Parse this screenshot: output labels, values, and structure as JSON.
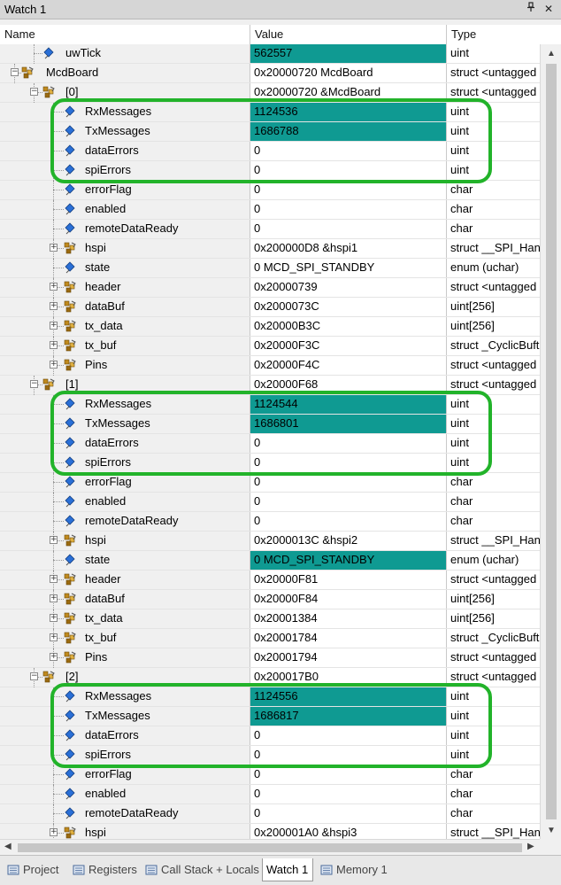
{
  "window": {
    "title": "Watch 1",
    "pin_glyph": "📌",
    "close_glyph": "✕"
  },
  "columns": {
    "name": "Name",
    "value": "Value",
    "type": "Type"
  },
  "rows": [
    {
      "name": "uwTick",
      "value": "562557",
      "type": "uint",
      "depth": 1,
      "expander": "none",
      "icon": "variable-icon",
      "highlight": true
    },
    {
      "name": "McdBoard",
      "value": "0x20000720 McdBoard",
      "type": "struct <untagged",
      "depth": 0,
      "expander": "minus",
      "icon": "struct-icon",
      "highlight": false
    },
    {
      "name": "[0]",
      "value": "0x20000720 &McdBoard",
      "type": "struct <untagged",
      "depth": 1,
      "expander": "minus",
      "icon": "struct-icon",
      "highlight": false
    },
    {
      "name": "RxMessages",
      "value": "1124536",
      "type": "uint",
      "depth": 2,
      "expander": "none",
      "icon": "variable-icon",
      "highlight": true
    },
    {
      "name": "TxMessages",
      "value": "1686788",
      "type": "uint",
      "depth": 2,
      "expander": "none",
      "icon": "variable-icon",
      "highlight": true
    },
    {
      "name": "dataErrors",
      "value": "0",
      "type": "uint",
      "depth": 2,
      "expander": "none",
      "icon": "variable-icon",
      "highlight": false
    },
    {
      "name": "spiErrors",
      "value": "0",
      "type": "uint",
      "depth": 2,
      "expander": "none",
      "icon": "variable-icon",
      "highlight": false
    },
    {
      "name": "errorFlag",
      "value": "0",
      "type": "char",
      "depth": 2,
      "expander": "none",
      "icon": "variable-icon",
      "highlight": false
    },
    {
      "name": "enabled",
      "value": "0",
      "type": "char",
      "depth": 2,
      "expander": "none",
      "icon": "variable-icon",
      "highlight": false
    },
    {
      "name": "remoteDataReady",
      "value": "0",
      "type": "char",
      "depth": 2,
      "expander": "none",
      "icon": "variable-icon",
      "highlight": false
    },
    {
      "name": "hspi",
      "value": "0x200000D8 &hspi1",
      "type": "struct __SPI_Hanc",
      "depth": 2,
      "expander": "plus",
      "icon": "struct-icon",
      "highlight": false
    },
    {
      "name": "state",
      "value": "0 MCD_SPI_STANDBY",
      "type": "enum (uchar)",
      "depth": 2,
      "expander": "none",
      "icon": "variable-icon",
      "highlight": false
    },
    {
      "name": "header",
      "value": "0x20000739",
      "type": "struct <untagged",
      "depth": 2,
      "expander": "plus",
      "icon": "struct-icon",
      "highlight": false
    },
    {
      "name": "dataBuf",
      "value": "0x2000073C",
      "type": "uint[256]",
      "depth": 2,
      "expander": "plus",
      "icon": "struct-icon",
      "highlight": false
    },
    {
      "name": "tx_data",
      "value": "0x20000B3C",
      "type": "uint[256]",
      "depth": 2,
      "expander": "plus",
      "icon": "struct-icon",
      "highlight": false
    },
    {
      "name": "tx_buf",
      "value": "0x20000F3C",
      "type": "struct _CyclicBuft",
      "depth": 2,
      "expander": "plus",
      "icon": "struct-icon",
      "highlight": false
    },
    {
      "name": "Pins",
      "value": "0x20000F4C",
      "type": "struct <untagged",
      "depth": 2,
      "expander": "plus",
      "icon": "struct-icon",
      "highlight": false
    },
    {
      "name": "[1]",
      "value": "0x20000F68",
      "type": "struct <untagged",
      "depth": 1,
      "expander": "minus",
      "icon": "struct-icon",
      "highlight": false
    },
    {
      "name": "RxMessages",
      "value": "1124544",
      "type": "uint",
      "depth": 2,
      "expander": "none",
      "icon": "variable-icon",
      "highlight": true
    },
    {
      "name": "TxMessages",
      "value": "1686801",
      "type": "uint",
      "depth": 2,
      "expander": "none",
      "icon": "variable-icon",
      "highlight": true
    },
    {
      "name": "dataErrors",
      "value": "0",
      "type": "uint",
      "depth": 2,
      "expander": "none",
      "icon": "variable-icon",
      "highlight": false
    },
    {
      "name": "spiErrors",
      "value": "0",
      "type": "uint",
      "depth": 2,
      "expander": "none",
      "icon": "variable-icon",
      "highlight": false
    },
    {
      "name": "errorFlag",
      "value": "0",
      "type": "char",
      "depth": 2,
      "expander": "none",
      "icon": "variable-icon",
      "highlight": false
    },
    {
      "name": "enabled",
      "value": "0",
      "type": "char",
      "depth": 2,
      "expander": "none",
      "icon": "variable-icon",
      "highlight": false
    },
    {
      "name": "remoteDataReady",
      "value": "0",
      "type": "char",
      "depth": 2,
      "expander": "none",
      "icon": "variable-icon",
      "highlight": false
    },
    {
      "name": "hspi",
      "value": "0x2000013C &hspi2",
      "type": "struct __SPI_Hanc",
      "depth": 2,
      "expander": "plus",
      "icon": "struct-icon",
      "highlight": false
    },
    {
      "name": "state",
      "value": "0 MCD_SPI_STANDBY",
      "type": "enum (uchar)",
      "depth": 2,
      "expander": "none",
      "icon": "variable-icon",
      "highlight": true
    },
    {
      "name": "header",
      "value": "0x20000F81",
      "type": "struct <untagged",
      "depth": 2,
      "expander": "plus",
      "icon": "struct-icon",
      "highlight": false
    },
    {
      "name": "dataBuf",
      "value": "0x20000F84",
      "type": "uint[256]",
      "depth": 2,
      "expander": "plus",
      "icon": "struct-icon",
      "highlight": false
    },
    {
      "name": "tx_data",
      "value": "0x20001384",
      "type": "uint[256]",
      "depth": 2,
      "expander": "plus",
      "icon": "struct-icon",
      "highlight": false
    },
    {
      "name": "tx_buf",
      "value": "0x20001784",
      "type": "struct _CyclicBuft",
      "depth": 2,
      "expander": "plus",
      "icon": "struct-icon",
      "highlight": false
    },
    {
      "name": "Pins",
      "value": "0x20001794",
      "type": "struct <untagged",
      "depth": 2,
      "expander": "plus",
      "icon": "struct-icon",
      "highlight": false
    },
    {
      "name": "[2]",
      "value": "0x200017B0",
      "type": "struct <untagged",
      "depth": 1,
      "expander": "minus",
      "icon": "struct-icon",
      "highlight": false
    },
    {
      "name": "RxMessages",
      "value": "1124556",
      "type": "uint",
      "depth": 2,
      "expander": "none",
      "icon": "variable-icon",
      "highlight": true
    },
    {
      "name": "TxMessages",
      "value": "1686817",
      "type": "uint",
      "depth": 2,
      "expander": "none",
      "icon": "variable-icon",
      "highlight": true
    },
    {
      "name": "dataErrors",
      "value": "0",
      "type": "uint",
      "depth": 2,
      "expander": "none",
      "icon": "variable-icon",
      "highlight": false
    },
    {
      "name": "spiErrors",
      "value": "0",
      "type": "uint",
      "depth": 2,
      "expander": "none",
      "icon": "variable-icon",
      "highlight": false
    },
    {
      "name": "errorFlag",
      "value": "0",
      "type": "char",
      "depth": 2,
      "expander": "none",
      "icon": "variable-icon",
      "highlight": false
    },
    {
      "name": "enabled",
      "value": "0",
      "type": "char",
      "depth": 2,
      "expander": "none",
      "icon": "variable-icon",
      "highlight": false
    },
    {
      "name": "remoteDataReady",
      "value": "0",
      "type": "char",
      "depth": 2,
      "expander": "none",
      "icon": "variable-icon",
      "highlight": false
    },
    {
      "name": "hspi",
      "value": "0x200001A0 &hspi3",
      "type": "struct __SPI_Hanc",
      "depth": 2,
      "expander": "plus",
      "icon": "struct-icon",
      "highlight": false
    }
  ],
  "tabs": [
    {
      "label": "Project",
      "icon": "project-icon",
      "active": false
    },
    {
      "label": "Registers",
      "icon": "registers-icon",
      "active": false
    },
    {
      "label": "Call Stack + Locals",
      "icon": "call-stack-icon",
      "active": false
    },
    {
      "label": "Watch 1",
      "icon": "",
      "active": true
    },
    {
      "label": "Memory 1",
      "icon": "memory-icon",
      "active": false
    }
  ],
  "colors": {
    "highlight": "#0f9a92",
    "selection_outline": "#22b32a",
    "struct_icon": "#c08a1e",
    "variable_icon": "#2a6fd6"
  }
}
